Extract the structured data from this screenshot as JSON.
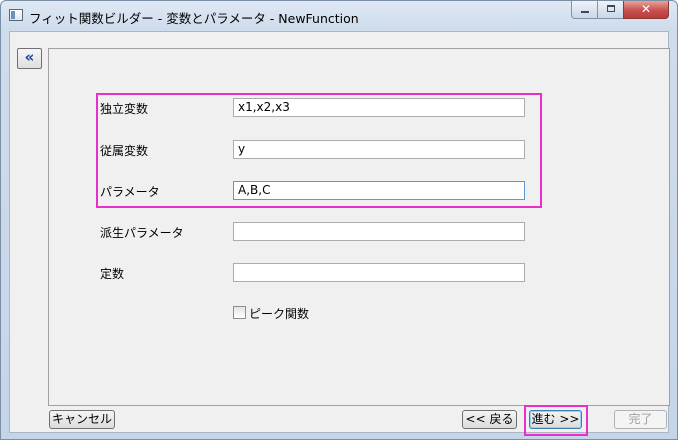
{
  "window": {
    "title": "フィット関数ビルダー - 変数とパラメータ - NewFunction",
    "minimize": "",
    "maximize": "",
    "close": "✕"
  },
  "sidebar": {
    "collapse_label": "«"
  },
  "form": {
    "independent": {
      "label": "独立変数",
      "value": "x1,x2,x3"
    },
    "dependent": {
      "label": "従属変数",
      "value": "y"
    },
    "parameters": {
      "label": "パラメータ",
      "value": "A,B,C"
    },
    "derived": {
      "label": "派生パラメータ",
      "value": ""
    },
    "constants": {
      "label": "定数",
      "value": ""
    },
    "peak": {
      "label": "ピーク関数",
      "checked": false
    }
  },
  "buttons": {
    "cancel": "キャンセル",
    "back": "<< 戻る",
    "next": "進む >>",
    "finish": "完了"
  },
  "colors": {
    "highlight": "#e830c8",
    "client_bg": "#f0f0f0",
    "close_button": "#c75050"
  }
}
